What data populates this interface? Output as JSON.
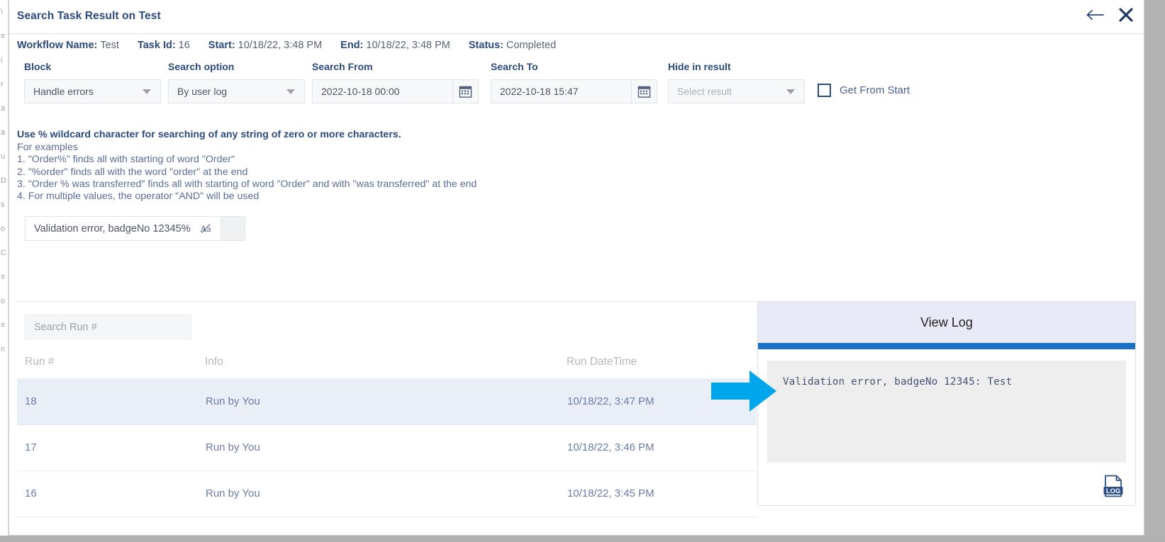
{
  "window": {
    "title": "Search Task Result on Test",
    "back_icon": "back-arrow-icon",
    "close_icon": "close-icon"
  },
  "meta": [
    {
      "key": "Workflow Name:",
      "value": "Test"
    },
    {
      "key": "Task Id:",
      "value": "16"
    },
    {
      "key": "Start:",
      "value": "10/18/22, 3:48 PM"
    },
    {
      "key": "End:",
      "value": "10/18/22, 3:48 PM"
    },
    {
      "key": "Status:",
      "value": "Completed"
    }
  ],
  "filters": {
    "block": {
      "label": "Block",
      "value": "Handle errors"
    },
    "search_option": {
      "label": "Search option",
      "value": "By user log"
    },
    "search_from": {
      "label": "Search From",
      "value": "2022-10-18 00:00",
      "calendar_icon": "calendar-icon"
    },
    "search_to": {
      "label": "Search To",
      "value": "2022-10-18 15:47",
      "calendar_icon": "calendar-icon"
    },
    "hide_in_result": {
      "label": "Hide in result",
      "placeholder": "Select result"
    },
    "get_from_start": {
      "label": "Get From Start",
      "checked": false
    }
  },
  "help": {
    "heading": "Use % wildcard character for searching of any string of zero or more characters.",
    "lines": [
      "For examples",
      "1. \"Order%\" finds all with starting of word \"Order\"",
      "2. \"%order\" finds all with the word \"order\" at the end",
      "3. \"Order % was transferred\" finds all with starting of word \"Order\" and with \"was transferred\" at the end",
      "4. For multiple values, the operator \"AND\" will be used"
    ]
  },
  "search_chip": {
    "text": "Validation error, badgeNo 12345%",
    "match_case_icon": "match-case-icon"
  },
  "results": {
    "run_search_placeholder": "Search Run #",
    "columns": [
      "Run #",
      "Info",
      "Run DateTime"
    ],
    "rows": [
      {
        "run": "18",
        "info": "Run by You",
        "datetime": "10/18/22, 3:47 PM",
        "selected": true
      },
      {
        "run": "17",
        "info": "Run by You",
        "datetime": "10/18/22, 3:46 PM",
        "selected": false
      },
      {
        "run": "16",
        "info": "Run by You",
        "datetime": "10/18/22, 3:45 PM",
        "selected": false
      }
    ]
  },
  "log_panel": {
    "title": "View Log",
    "content": "Validation error, badgeNo 12345: Test",
    "download_icon": "log-file-icon"
  },
  "annotation": {
    "arrow_icon": "pointer-arrow-icon",
    "arrow_color": "#00a6ec"
  },
  "colors": {
    "brand_navy": "#2b4a7e",
    "accent_blue": "#1d71c4",
    "row_selected": "#e9eef7",
    "panel_header": "#e8ebf7",
    "log_bg": "#eeeeee"
  },
  "background_left_glyphs": [
    "\\",
    "",
    "",
    "",
    "",
    "≡",
    "i",
    "r",
    "a",
    "a",
    "u",
    "",
    "D",
    "s",
    "o",
    "C",
    "≡",
    "o",
    "≡",
    "n"
  ]
}
